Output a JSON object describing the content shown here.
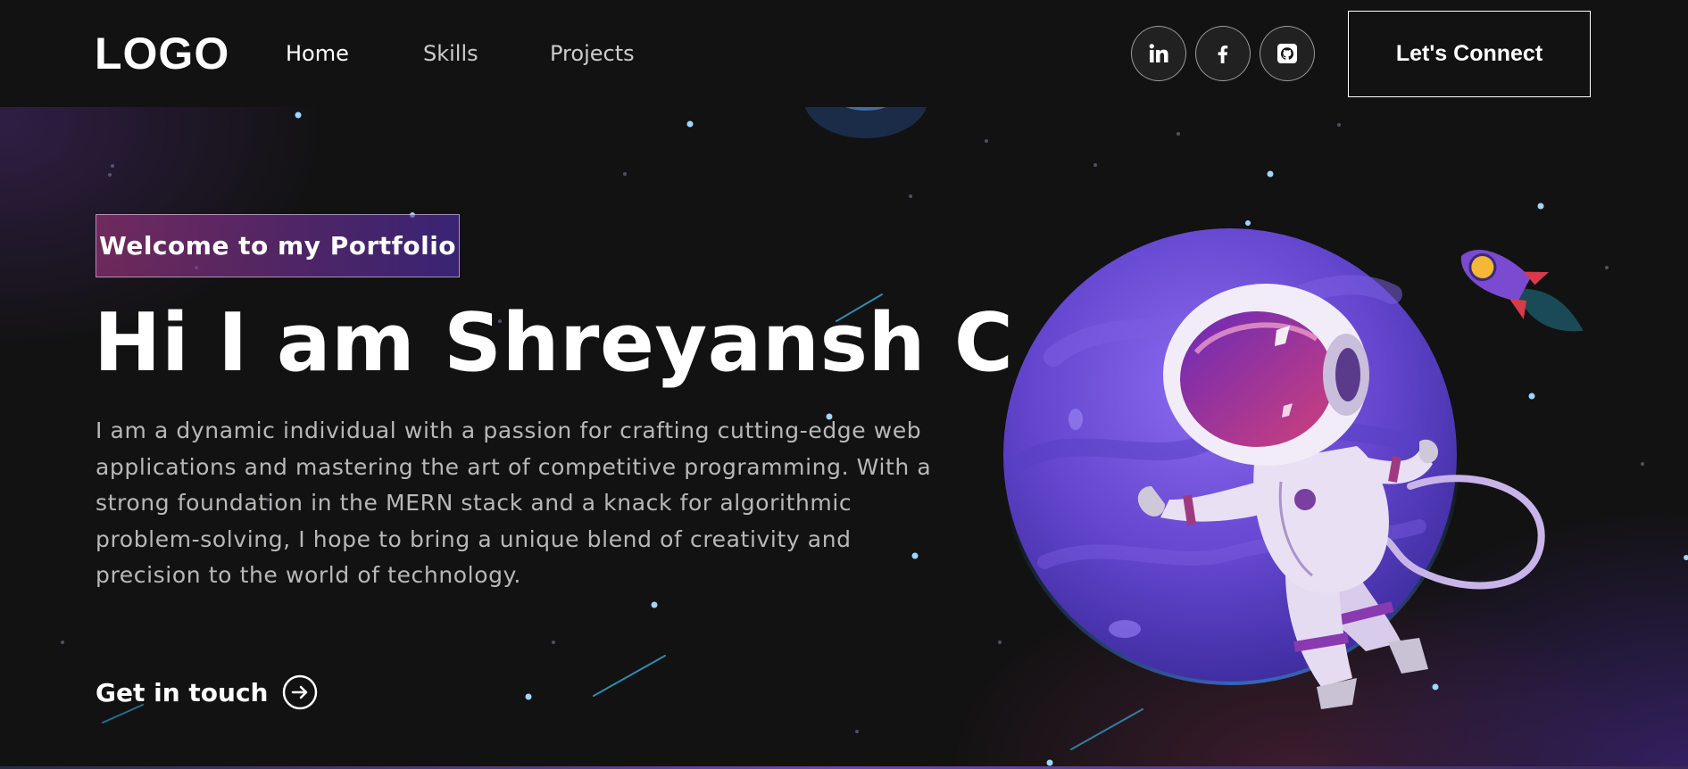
{
  "navbar": {
    "logo": "LOGO",
    "links": [
      {
        "label": "Home",
        "active": true
      },
      {
        "label": "Skills",
        "active": false
      },
      {
        "label": "Projects",
        "active": false
      }
    ],
    "social": [
      {
        "icon": "linkedin-icon"
      },
      {
        "icon": "facebook-icon"
      },
      {
        "icon": "github-icon"
      }
    ],
    "connect_label": "Let's Connect"
  },
  "hero": {
    "tagline": "Welcome to my Portfolio",
    "title": "Hi I am Shreyansh C",
    "description": "I am a dynamic individual with a passion for crafting cutting-edge web applications and mastering the art of competitive programming. With a strong foundation in the MERN stack and a knack for algorithmic problem-solving, I hope to bring a unique blend of creativity and precision to the world of technology.",
    "cta_label": "Get in touch",
    "cta_icon": "arrow-right-circle-icon",
    "illustration": "astronaut-planet-illustration"
  },
  "colors": {
    "background": "#121212",
    "tagline_gradient_start": "#aa367c",
    "tagline_gradient_end": "#4a2fbd",
    "planet": "#6a4ad6",
    "text_muted": "#b8b8b8"
  }
}
